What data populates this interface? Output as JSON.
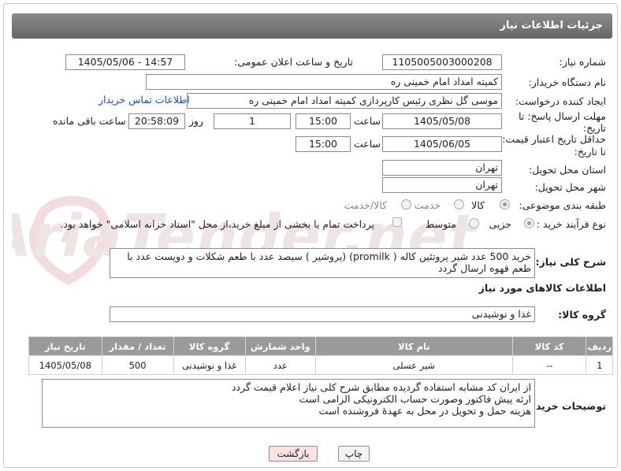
{
  "header": {
    "title": "جزئیات اطلاعات نیاز"
  },
  "form": {
    "need_number_label": "شماره نیاز:",
    "need_number": "1105005003000208",
    "announce_label": "تاریخ و ساعت اعلان عمومی:",
    "announce_value": "1405/05/06 - 14:57",
    "buyer_org_label": "نام دستگاه خریدار:",
    "buyer_org": "کمیته امداد امام خمینی ره",
    "creator_label": "ایجاد کننده درخواست:",
    "creator": "موسی گل نظری رئیس کارپردازی کمیته امداد امام خمینی ره",
    "contact_link": "اطلاعات تماس خریدار",
    "deadline_label_1": "مهلت ارسال پاسخ: تا",
    "deadline_label_2": "تاریخ:",
    "deadline_date": "1405/05/08",
    "time_label": "ساعت",
    "deadline_time": "15:00",
    "days_value": "1",
    "days_label": "روز و",
    "remaining_time": "20:58:09",
    "remaining_label": "ساعت باقی مانده",
    "validity_label_1": "حداقل تاریخ اعتبار قیمت:",
    "validity_label_2": "تا تاریخ:",
    "validity_date": "1405/06/05",
    "validity_time": "15:00",
    "province_label": "استان محل تحویل:",
    "province": "تهران",
    "city_label": "شهر محل تحویل:",
    "city": "تهران",
    "category_label": "طبقه بندی موضوعی:",
    "category_options": [
      "کالا",
      "خدمت",
      "کالا/خدمت"
    ],
    "process_label": "نوع فرآیند خرید :",
    "process_options": [
      "جزیی",
      "متوسط"
    ],
    "payment_note": "پرداخت تمام یا بخشی از مبلغ خرید،از محل \"اسناد خزانه اسلامی\" خواهد بود."
  },
  "description": {
    "label": "شرح کلی نیاز:",
    "text": "خرید 500 عدد شیر پروتئین کاله ( promilk) (پروشیر )  سیصد عدد با طعم شکلات و دویست عدد با طعم قهوه ارسال گردد"
  },
  "goods": {
    "section_title": "اطلاعات کالاهای مورد نیاز",
    "group_label": "گروه کالا:",
    "group_value": "غذا و نوشیدنی",
    "columns": [
      "ردیف",
      "کد کالا",
      "نام کالا",
      "واحد شمارش",
      "گروه کالا",
      "تعداد / مقدار",
      "تاریخ نیاز"
    ],
    "rows": [
      [
        "1",
        "--",
        "شیر عسلی",
        "عدد",
        "غذا و نوشیدنی",
        "500",
        "1405/05/08"
      ]
    ]
  },
  "notes": {
    "label": "توضیحات خریدار:",
    "lines": [
      "از ایران کد مشابه استفاده گردیده مطابق شرح کلی نیاز اعلام قیمت گردد",
      "ارئه پیش فاکتور وصورت حساب الکترونیکی الزامی است",
      "هزینه حمل و تحویل در محل به عهدهٔ فروشنده است"
    ]
  },
  "buttons": {
    "print": "چاپ",
    "back": "بازگشت"
  },
  "watermark": {
    "text": "AriaTender.net"
  },
  "colors": {
    "title_bar": "#777777",
    "link": "#1a4fb5",
    "table_header": "#9a9a9a",
    "back_button": "#fde2e2"
  }
}
